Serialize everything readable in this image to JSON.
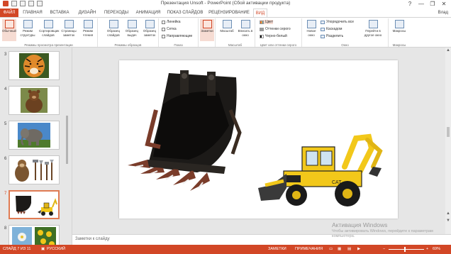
{
  "window": {
    "title": "Презентация Unsoft - PowerPoint (Сбой активации продукта)",
    "controls": [
      "?",
      "—",
      "❐",
      "✕"
    ],
    "user": "Влад"
  },
  "tabs": [
    "ФАЙЛ",
    "ГЛАВНАЯ",
    "ВСТАВКА",
    "ДИЗАЙН",
    "ПЕРЕХОДЫ",
    "АНИМАЦИЯ",
    "ПОКАЗ СЛАЙДОВ",
    "РЕЦЕНЗИРОВАНИЕ",
    "ВИД"
  ],
  "active_tab": "ВИД",
  "ribbon": {
    "presentation_views": {
      "label": "Режимы просмотра презентации",
      "buttons": [
        "Обычный",
        "Режим структуры",
        "Сортировщик слайдов",
        "Страницы заметок",
        "Режим чтения"
      ]
    },
    "master_views": {
      "label": "Режимы образцов",
      "buttons": [
        "Образец слайдов",
        "Образец выдач",
        "Образец заметок"
      ]
    },
    "show": {
      "label": "Показ",
      "items": [
        "Линейка",
        "Сетка",
        "Направляющие"
      ]
    },
    "notes_btn": "Заметки",
    "zoom": {
      "label": "Масштаб",
      "buttons": [
        "Масштаб",
        "Вписать в окно"
      ]
    },
    "color": {
      "label": "Цвет или оттенки серого",
      "items": [
        "Цвет",
        "Оттенки серого",
        "Черно-белый"
      ]
    },
    "window_group": {
      "label": "Окно",
      "new_window": "Новое окно",
      "items": [
        "Упорядочить все",
        "Каскадом",
        "Разделить"
      ],
      "switch": "Перейти в другое окно"
    },
    "macros": {
      "label": "Макросы",
      "button": "Макросы"
    }
  },
  "thumbnails": [
    {
      "num": "3",
      "subject": "tiger"
    },
    {
      "num": "4",
      "subject": "bear"
    },
    {
      "num": "5",
      "subject": "elephant"
    },
    {
      "num": "6",
      "subject": "monkey and tools"
    },
    {
      "num": "7",
      "subject": "bucket and backhoe loader",
      "active": true
    },
    {
      "num": "8",
      "subject": "flowers"
    }
  ],
  "notes_placeholder": "Заметки к слайду",
  "activation": {
    "title": "Активация Windows",
    "subtitle": "Чтобы активировать Windows, перейдите к параметрам компьютера."
  },
  "status": {
    "slide": "СЛАЙД 7 ИЗ 11",
    "language": "РУССКИЙ",
    "notes": "ЗАМЕТКИ",
    "comments": "ПРИМЕЧАНИЯ",
    "zoom": "69%"
  },
  "colors": {
    "accent": "#d24726",
    "bucket_body": "#1c1a18",
    "bucket_teeth": "#7a3c2a",
    "loader_yellow": "#f2c81a"
  }
}
